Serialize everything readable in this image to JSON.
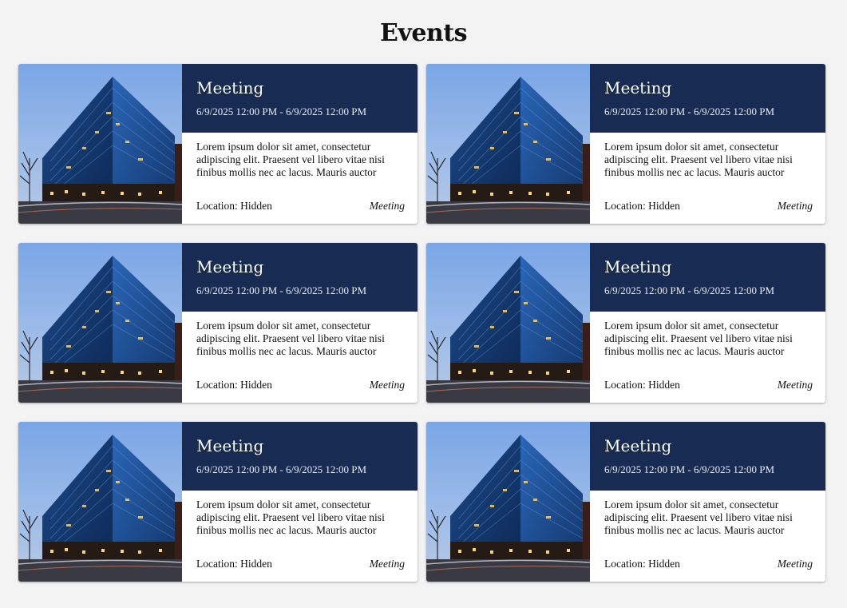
{
  "page": {
    "title": "Events"
  },
  "events": [
    {
      "title": "Meeting",
      "date": "6/9/2025 12:00 PM - 6/9/2025 12:00 PM",
      "description": "Lorem ipsum dolor sit amet, consectetur adipiscing elit. Praesent vel libero vitae nisi finibus mollis nec ac lacus. Mauris auctor",
      "location": "Location: Hidden",
      "category": "Meeting",
      "image": "office-building-photo"
    },
    {
      "title": "Meeting",
      "date": "6/9/2025 12:00 PM - 6/9/2025 12:00 PM",
      "description": "Lorem ipsum dolor sit amet, consectetur adipiscing elit. Praesent vel libero vitae nisi finibus mollis nec ac lacus. Mauris auctor",
      "location": "Location: Hidden",
      "category": "Meeting",
      "image": "office-building-photo"
    },
    {
      "title": "Meeting",
      "date": "6/9/2025 12:00 PM - 6/9/2025 12:00 PM",
      "description": "Lorem ipsum dolor sit amet, consectetur adipiscing elit. Praesent vel libero vitae nisi finibus mollis nec ac lacus. Mauris auctor",
      "location": "Location: Hidden",
      "category": "Meeting",
      "image": "office-building-photo"
    },
    {
      "title": "Meeting",
      "date": "6/9/2025 12:00 PM - 6/9/2025 12:00 PM",
      "description": "Lorem ipsum dolor sit amet, consectetur adipiscing elit. Praesent vel libero vitae nisi finibus mollis nec ac lacus. Mauris auctor",
      "location": "Location: Hidden",
      "category": "Meeting",
      "image": "office-building-photo"
    },
    {
      "title": "Meeting",
      "date": "6/9/2025 12:00 PM - 6/9/2025 12:00 PM",
      "description": "Lorem ipsum dolor sit amet, consectetur adipiscing elit. Praesent vel libero vitae nisi finibus mollis nec ac lacus. Mauris auctor",
      "location": "Location: Hidden",
      "category": "Meeting",
      "image": "office-building-photo"
    },
    {
      "title": "Meeting",
      "date": "6/9/2025 12:00 PM - 6/9/2025 12:00 PM",
      "description": "Lorem ipsum dolor sit amet, consectetur adipiscing elit. Praesent vel libero vitae nisi finibus mollis nec ac lacus. Mauris auctor",
      "location": "Location: Hidden",
      "category": "Meeting",
      "image": "office-building-photo"
    }
  ],
  "colors": {
    "background": "#f3f3f3",
    "header": "#182b52",
    "card": "#ffffff"
  }
}
